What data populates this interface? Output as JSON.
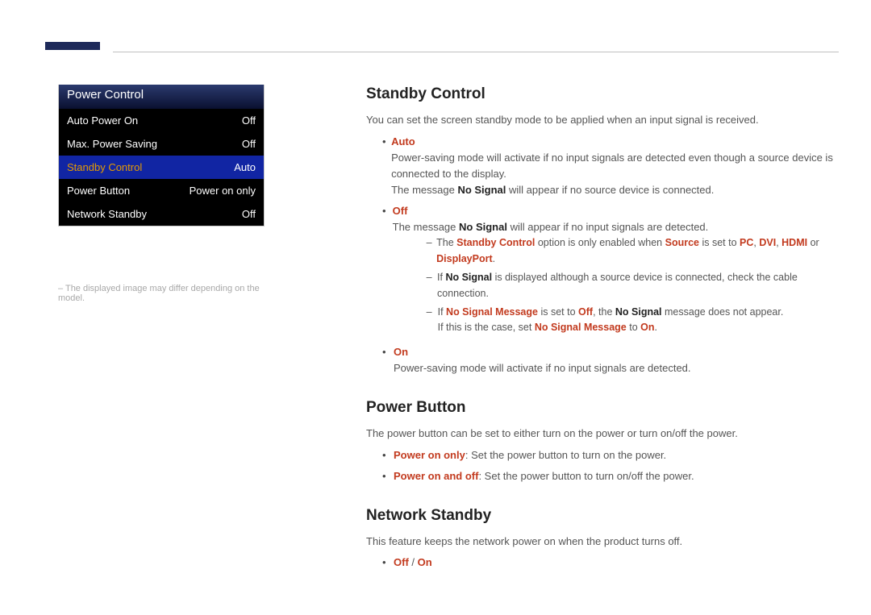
{
  "panel": {
    "title": "Power Control",
    "rows": {
      "auto": {
        "label": "Auto Power On",
        "value": "Off"
      },
      "max": {
        "label": "Max. Power Saving",
        "value": "Off"
      },
      "standby": {
        "label": "Standby Control",
        "value": "Auto"
      },
      "power": {
        "label": "Power Button",
        "value": "Power on only"
      },
      "network": {
        "label": "Network Standby",
        "value": "Off"
      }
    }
  },
  "disclaimer": "– The displayed image may differ depending on the model.",
  "sections": {
    "standby": {
      "heading": "Standby Control",
      "intro": "You can set the screen standby mode to be applied when an input signal is received.",
      "auto": {
        "label": "Auto",
        "line1": "Power-saving mode will activate if no input signals are detected even though a source device is connected to the display.",
        "line2_pre": "The message ",
        "line2_em": "No Signal",
        "line2_post": " will appear if no source device is connected."
      },
      "off": {
        "label": "Off",
        "line_pre": "The message ",
        "line_em": "No Signal",
        "line_post": " will appear if no input signals are detected.",
        "note1_pre": "The ",
        "note1_em1": "Standby Control",
        "note1_mid": " option is only enabled when ",
        "note1_em2": "Source",
        "note1_mid2": " is set to ",
        "note1_em3": "PC",
        "note1_sep": ", ",
        "note1_em4": "DVI",
        "note1_em5": "HDMI",
        "note1_or": " or ",
        "note1_em6": "DisplayPort",
        "note1_end": ".",
        "note2_pre": "If ",
        "note2_em1": "No Signal",
        "note2_post": " is displayed although a source device is connected, check the cable connection.",
        "note3_pre": "If ",
        "note3_em1": "No Signal Message",
        "note3_mid1": " is set to ",
        "note3_em2": "Off",
        "note3_mid2": ", the ",
        "note3_em3": "No Signal",
        "note3_post": " message does not appear.",
        "note3b_pre": "If this is the case, set ",
        "note3b_em1": "No Signal Message",
        "note3b_mid": " to ",
        "note3b_em2": "On",
        "note3b_end": "."
      },
      "on": {
        "label": "On",
        "line": "Power-saving mode will activate if no input signals are detected."
      }
    },
    "powerbtn": {
      "heading": "Power Button",
      "intro": "The power button can be set to either turn on the power or turn on/off the power.",
      "opt1_em": "Power on only",
      "opt1_post": ": Set the power button to turn on the power.",
      "opt2_em": "Power on and off",
      "opt2_post": ": Set the power button to turn on/off the power."
    },
    "network": {
      "heading": "Network Standby",
      "intro": "This feature keeps the network power on when the product turns off.",
      "opt_em1": "Off",
      "slash": " / ",
      "opt_em2": "On"
    }
  },
  "glyphs": {
    "bullet": "•",
    "sub": "–"
  }
}
